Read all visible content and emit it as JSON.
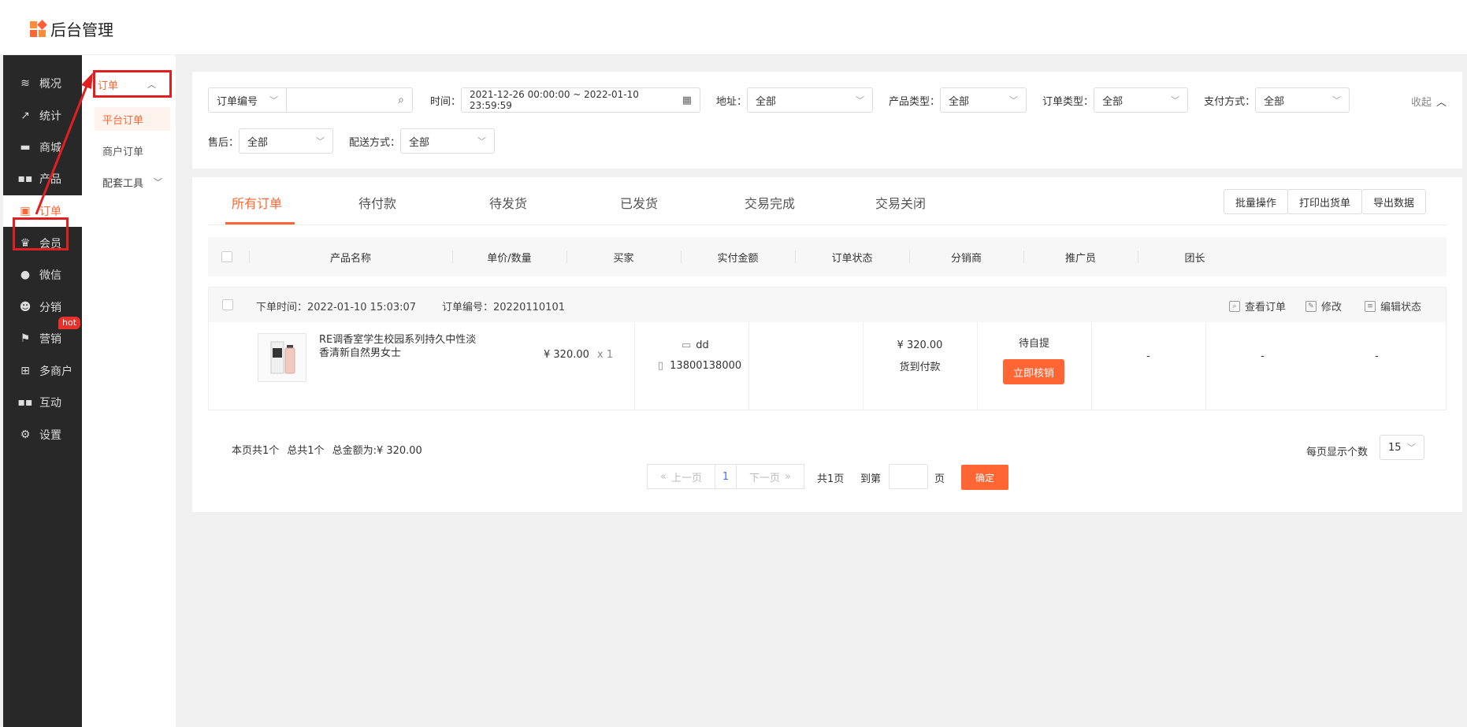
{
  "app": {
    "title": "后台管理"
  },
  "sidebar": {
    "items": [
      {
        "label": "概况",
        "icon": "layers-icon"
      },
      {
        "label": "统计",
        "icon": "chart-icon"
      },
      {
        "label": "商城",
        "icon": "shop-icon"
      },
      {
        "label": "产品",
        "icon": "grid-icon"
      },
      {
        "label": "订单",
        "icon": "order-icon",
        "active": true
      },
      {
        "label": "会员",
        "icon": "crown-icon"
      },
      {
        "label": "微信",
        "icon": "wechat-icon"
      },
      {
        "label": "分销",
        "icon": "users-icon"
      },
      {
        "label": "营销",
        "icon": "flag-icon",
        "badge": "hot"
      },
      {
        "label": "多商户",
        "icon": "store-icon"
      },
      {
        "label": "互动",
        "icon": "apps-icon"
      },
      {
        "label": "设置",
        "icon": "gear-icon"
      }
    ]
  },
  "submenu": {
    "head": "订单",
    "items": [
      "平台订单",
      "商户订单"
    ],
    "tools": "配套工具"
  },
  "filters": {
    "order_no_select": "订单编号",
    "time_label": "时间：",
    "time_value": "2021-12-26 00:00:00 ~ 2022-01-10 23:59:59",
    "address_label": "地址：",
    "address_value": "全部",
    "product_type_label": "产品类型：",
    "product_type_value": "全部",
    "order_type_label": "订单类型：",
    "order_type_value": "全部",
    "pay_label": "支付方式：",
    "pay_value": "全部",
    "collapse": "收起",
    "after_sale_label": "售后：",
    "after_sale_value": "全部",
    "delivery_label": "配送方式：",
    "delivery_value": "全部"
  },
  "tabs": [
    "所有订单",
    "待付款",
    "待发货",
    "已发货",
    "交易完成",
    "交易关闭"
  ],
  "actions": [
    "批量操作",
    "打印出货单",
    "导出数据"
  ],
  "table": {
    "columns": [
      "产品名称",
      "单价/数量",
      "买家",
      "实付金额",
      "订单状态",
      "分销商",
      "推广员",
      "团长"
    ]
  },
  "order": {
    "time": "下单时间：2022-01-10 15:03:07",
    "number": "订单编号：20220110101",
    "ops": [
      "查看订单",
      "修改",
      "编辑状态"
    ],
    "product_name": "RE调香室学生校园系列持久中性淡香清新自然男女士",
    "price": "¥ 320.00",
    "qty": "x 1",
    "buyer_name": "dd",
    "buyer_phone": "13800138000",
    "paid": "¥ 320.00",
    "pay_method": "货到付款",
    "status": "待自提",
    "verify_button": "立即核销",
    "distributor": "-",
    "promoter": "-",
    "leader": "-"
  },
  "summary": {
    "page_count": "本页共1个",
    "total_count": "总共1个",
    "total_amount": "总金额为:¥ 320.00"
  },
  "pagination": {
    "prev": "上一页",
    "current": "1",
    "next": "下一页",
    "total_pages": "共1页",
    "goto": "到第",
    "page_unit": "页",
    "confirm": "确定",
    "per_page_label": "每页显示个数",
    "per_page_value": "15"
  },
  "colors": {
    "accent": "#ff6633",
    "sidebar": "#282828"
  }
}
